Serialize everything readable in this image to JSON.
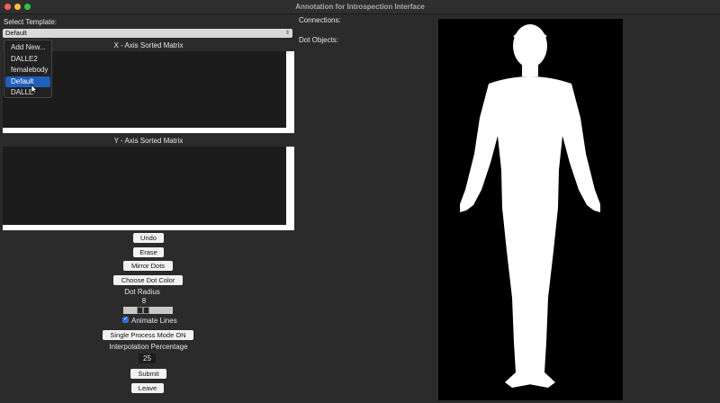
{
  "window": {
    "title": "Annotation for Introspection Interface"
  },
  "template": {
    "label": "Select Template:",
    "selected": "Default",
    "options": [
      "Add New...",
      "DALLE2",
      "femalebody",
      "Default",
      "DALLE"
    ]
  },
  "matrices": {
    "x_title": "X - Axis Sorted Matrix",
    "y_title": "Y - Axis Sorted Matrix"
  },
  "controls": {
    "undo": "Undo",
    "erase": "Erase",
    "mirror": "Mirror Dots",
    "choose_color": "Choose Dot Color",
    "dot_radius_label": "Dot Radius",
    "dot_radius_value": "8",
    "animate_label": "Animate Lines",
    "animate_checked": true,
    "single_process": "Single Process Mode ON",
    "interp_label": "Interpolation Percentage",
    "interp_value": "25",
    "submit": "Submit",
    "leave": "Leave"
  },
  "info": {
    "connections_label": "Connections:",
    "dot_objects_label": "Dot Objects:"
  },
  "colors": {
    "background": "#2b2b2b",
    "selection": "#1f5fbd",
    "canvas_bg": "#000000",
    "silhouette": "#ffffff"
  }
}
